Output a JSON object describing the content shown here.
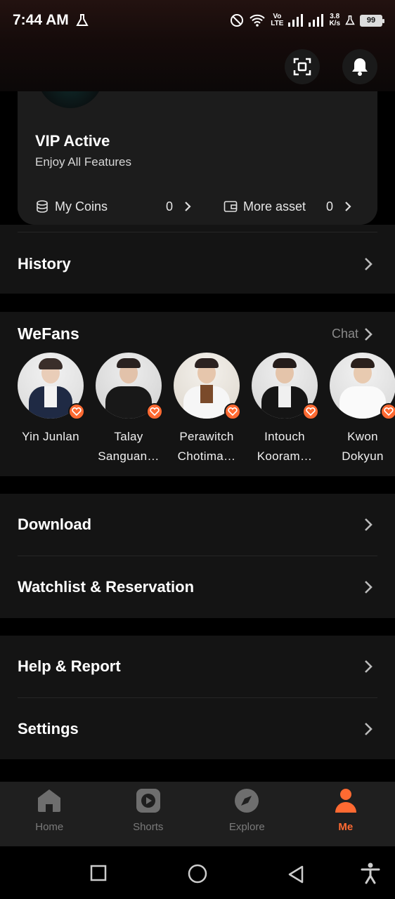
{
  "status_bar": {
    "time": "7:44 AM",
    "network_top": "Vo",
    "network_bottom": "LTE",
    "speed_top": "3.8",
    "speed_bottom": "K/s",
    "battery": "99"
  },
  "top_actions": {
    "scan_icon": "scan-icon",
    "bell_icon": "bell-icon"
  },
  "vip": {
    "title": "VIP Active",
    "subtitle": "Enjoy All Features",
    "coins_label": "My Coins",
    "coins_value": "0",
    "asset_label": "More asset",
    "asset_value": "0"
  },
  "history": {
    "label": "History"
  },
  "wefans": {
    "title": "WeFans",
    "chat_label": "Chat",
    "items": [
      {
        "line1": "Yin Junlan",
        "line2": ""
      },
      {
        "line1": "Talay",
        "line2": "Sanguan…"
      },
      {
        "line1": "Perawitch",
        "line2": "Chotima…"
      },
      {
        "line1": "Intouch",
        "line2": "Kooram…"
      },
      {
        "line1": "Kwon",
        "line2": "Dokyun"
      }
    ]
  },
  "menu": {
    "download": "Download",
    "watchlist": "Watchlist & Reservation",
    "help": "Help & Report",
    "settings": "Settings"
  },
  "bottom_nav": [
    {
      "label": "Home",
      "icon": "home-icon",
      "active": false
    },
    {
      "label": "Shorts",
      "icon": "play-icon",
      "active": false
    },
    {
      "label": "Explore",
      "icon": "compass-icon",
      "active": false
    },
    {
      "label": "Me",
      "icon": "person-icon",
      "active": true
    }
  ],
  "colors": {
    "accent": "#ff6a32",
    "background": "#000000",
    "card": "#141414"
  }
}
